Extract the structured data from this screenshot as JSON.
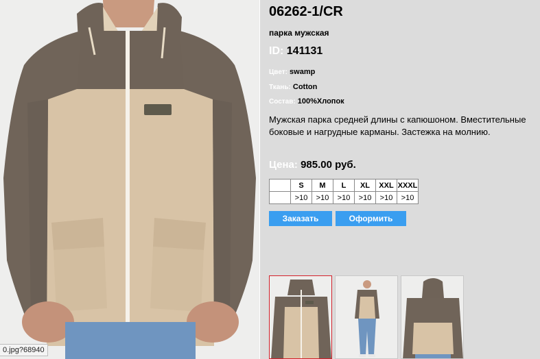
{
  "image_tooltip": "0.jpg?68940",
  "product": {
    "code": "06262-1/CR",
    "name": "парка мужская",
    "id_label": "ID:",
    "id_value": "141131",
    "color_label": "Цвет:",
    "color_value": "swamp",
    "fabric_label": "Ткань:",
    "fabric_value": "Cotton",
    "composition_label": "Состав:",
    "composition_value": "100%Хлопок",
    "description": "Мужская парка средней длины с капюшоном. Вместительные боковые и нагрудные карманы. Застежка на молнию.",
    "price_label": "Цена:",
    "price_value": "985.00 руб."
  },
  "sizes": {
    "headers": [
      "S",
      "M",
      "L",
      "XL",
      "XXL",
      "XXXL"
    ],
    "stock": [
      ">10",
      ">10",
      ">10",
      ">10",
      ">10",
      ">10"
    ]
  },
  "buttons": {
    "order": "Заказать",
    "checkout": "Оформить"
  },
  "colors": {
    "accent_button": "#3a9ef0",
    "panel_bg": "#dcdcdc",
    "label_color": "#ffffff",
    "jacket_dark": "#6e6258",
    "jacket_light": "#d9c4a8",
    "selected_thumb_border": "#d3202a"
  }
}
